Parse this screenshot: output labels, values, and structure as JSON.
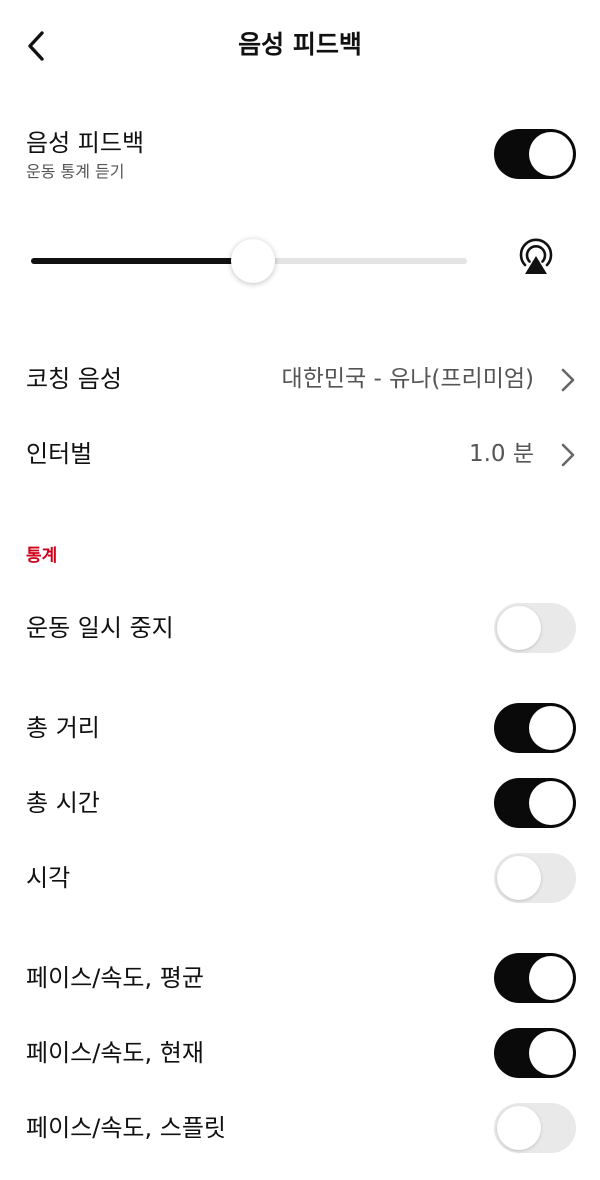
{
  "header": {
    "title": "음성 피드백",
    "back_icon": "chevron-left-icon"
  },
  "voice_feedback": {
    "label": "음성 피드백",
    "sublabel": "운동 통계 듣기",
    "enabled": true
  },
  "volume": {
    "level": 0.51,
    "output_icon": "airplay-icon"
  },
  "coaching_voice": {
    "label": "코칭 음성",
    "value": "대한민국 - 유나(프리미엄)"
  },
  "interval": {
    "label": "인터벌",
    "value": "1.0 분"
  },
  "stats": {
    "section_title": "통계",
    "items": [
      {
        "label": "운동 일시 중지",
        "enabled": false
      },
      {
        "label": "총 거리",
        "enabled": true
      },
      {
        "label": "총 시간",
        "enabled": true
      },
      {
        "label": "시각",
        "enabled": false
      },
      {
        "label": "페이스/속도, 평균",
        "enabled": true
      },
      {
        "label": "페이스/속도, 현재",
        "enabled": true
      },
      {
        "label": "페이스/속도, 스플릿",
        "enabled": false
      }
    ]
  },
  "colors": {
    "accent_red": "#d0021b",
    "toggle_on": "#0a0a0a",
    "toggle_off": "#e9e9e9"
  }
}
